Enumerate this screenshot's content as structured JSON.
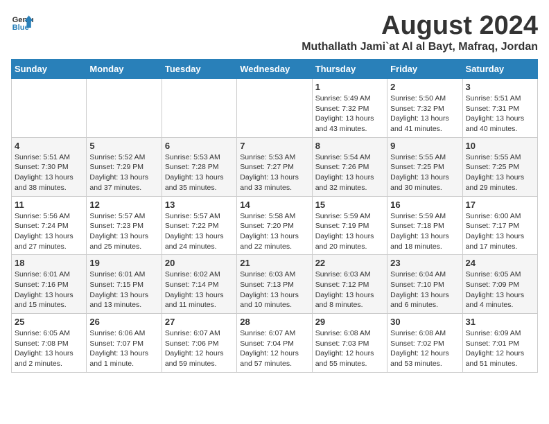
{
  "logo": {
    "text_general": "General",
    "text_blue": "Blue"
  },
  "title": "August 2024",
  "subtitle": "Muthallath Jami`at Al al Bayt, Mafraq, Jordan",
  "headers": [
    "Sunday",
    "Monday",
    "Tuesday",
    "Wednesday",
    "Thursday",
    "Friday",
    "Saturday"
  ],
  "weeks": [
    {
      "days": [
        {
          "number": "",
          "info": ""
        },
        {
          "number": "",
          "info": ""
        },
        {
          "number": "",
          "info": ""
        },
        {
          "number": "",
          "info": ""
        },
        {
          "number": "1",
          "info": "Sunrise: 5:49 AM\nSunset: 7:32 PM\nDaylight: 13 hours\nand 43 minutes."
        },
        {
          "number": "2",
          "info": "Sunrise: 5:50 AM\nSunset: 7:32 PM\nDaylight: 13 hours\nand 41 minutes."
        },
        {
          "number": "3",
          "info": "Sunrise: 5:51 AM\nSunset: 7:31 PM\nDaylight: 13 hours\nand 40 minutes."
        }
      ]
    },
    {
      "days": [
        {
          "number": "4",
          "info": "Sunrise: 5:51 AM\nSunset: 7:30 PM\nDaylight: 13 hours\nand 38 minutes."
        },
        {
          "number": "5",
          "info": "Sunrise: 5:52 AM\nSunset: 7:29 PM\nDaylight: 13 hours\nand 37 minutes."
        },
        {
          "number": "6",
          "info": "Sunrise: 5:53 AM\nSunset: 7:28 PM\nDaylight: 13 hours\nand 35 minutes."
        },
        {
          "number": "7",
          "info": "Sunrise: 5:53 AM\nSunset: 7:27 PM\nDaylight: 13 hours\nand 33 minutes."
        },
        {
          "number": "8",
          "info": "Sunrise: 5:54 AM\nSunset: 7:26 PM\nDaylight: 13 hours\nand 32 minutes."
        },
        {
          "number": "9",
          "info": "Sunrise: 5:55 AM\nSunset: 7:25 PM\nDaylight: 13 hours\nand 30 minutes."
        },
        {
          "number": "10",
          "info": "Sunrise: 5:55 AM\nSunset: 7:25 PM\nDaylight: 13 hours\nand 29 minutes."
        }
      ]
    },
    {
      "days": [
        {
          "number": "11",
          "info": "Sunrise: 5:56 AM\nSunset: 7:24 PM\nDaylight: 13 hours\nand 27 minutes."
        },
        {
          "number": "12",
          "info": "Sunrise: 5:57 AM\nSunset: 7:23 PM\nDaylight: 13 hours\nand 25 minutes."
        },
        {
          "number": "13",
          "info": "Sunrise: 5:57 AM\nSunset: 7:22 PM\nDaylight: 13 hours\nand 24 minutes."
        },
        {
          "number": "14",
          "info": "Sunrise: 5:58 AM\nSunset: 7:20 PM\nDaylight: 13 hours\nand 22 minutes."
        },
        {
          "number": "15",
          "info": "Sunrise: 5:59 AM\nSunset: 7:19 PM\nDaylight: 13 hours\nand 20 minutes."
        },
        {
          "number": "16",
          "info": "Sunrise: 5:59 AM\nSunset: 7:18 PM\nDaylight: 13 hours\nand 18 minutes."
        },
        {
          "number": "17",
          "info": "Sunrise: 6:00 AM\nSunset: 7:17 PM\nDaylight: 13 hours\nand 17 minutes."
        }
      ]
    },
    {
      "days": [
        {
          "number": "18",
          "info": "Sunrise: 6:01 AM\nSunset: 7:16 PM\nDaylight: 13 hours\nand 15 minutes."
        },
        {
          "number": "19",
          "info": "Sunrise: 6:01 AM\nSunset: 7:15 PM\nDaylight: 13 hours\nand 13 minutes."
        },
        {
          "number": "20",
          "info": "Sunrise: 6:02 AM\nSunset: 7:14 PM\nDaylight: 13 hours\nand 11 minutes."
        },
        {
          "number": "21",
          "info": "Sunrise: 6:03 AM\nSunset: 7:13 PM\nDaylight: 13 hours\nand 10 minutes."
        },
        {
          "number": "22",
          "info": "Sunrise: 6:03 AM\nSunset: 7:12 PM\nDaylight: 13 hours\nand 8 minutes."
        },
        {
          "number": "23",
          "info": "Sunrise: 6:04 AM\nSunset: 7:10 PM\nDaylight: 13 hours\nand 6 minutes."
        },
        {
          "number": "24",
          "info": "Sunrise: 6:05 AM\nSunset: 7:09 PM\nDaylight: 13 hours\nand 4 minutes."
        }
      ]
    },
    {
      "days": [
        {
          "number": "25",
          "info": "Sunrise: 6:05 AM\nSunset: 7:08 PM\nDaylight: 13 hours\nand 2 minutes."
        },
        {
          "number": "26",
          "info": "Sunrise: 6:06 AM\nSunset: 7:07 PM\nDaylight: 13 hours\nand 1 minute."
        },
        {
          "number": "27",
          "info": "Sunrise: 6:07 AM\nSunset: 7:06 PM\nDaylight: 12 hours\nand 59 minutes."
        },
        {
          "number": "28",
          "info": "Sunrise: 6:07 AM\nSunset: 7:04 PM\nDaylight: 12 hours\nand 57 minutes."
        },
        {
          "number": "29",
          "info": "Sunrise: 6:08 AM\nSunset: 7:03 PM\nDaylight: 12 hours\nand 55 minutes."
        },
        {
          "number": "30",
          "info": "Sunrise: 6:08 AM\nSunset: 7:02 PM\nDaylight: 12 hours\nand 53 minutes."
        },
        {
          "number": "31",
          "info": "Sunrise: 6:09 AM\nSunset: 7:01 PM\nDaylight: 12 hours\nand 51 minutes."
        }
      ]
    }
  ]
}
